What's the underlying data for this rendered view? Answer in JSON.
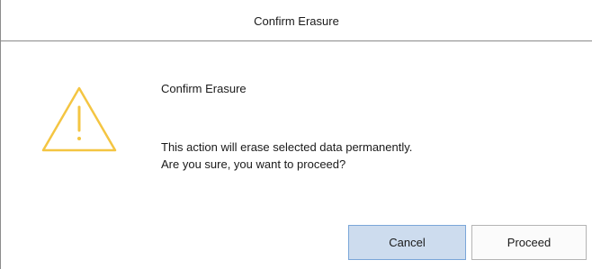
{
  "dialog": {
    "title": "Confirm Erasure",
    "heading": "Confirm Erasure",
    "message_line1": "This action will erase selected data permanently.",
    "message_line2": "Are you sure, you want to proceed?",
    "icon": "warning-triangle-icon",
    "icon_color": "#f4c542"
  },
  "buttons": {
    "cancel_label": "Cancel",
    "proceed_label": "Proceed"
  },
  "colors": {
    "cancel_bg": "#cddcee",
    "cancel_border": "#7aa6d8",
    "proceed_bg": "#fbfbfb"
  }
}
